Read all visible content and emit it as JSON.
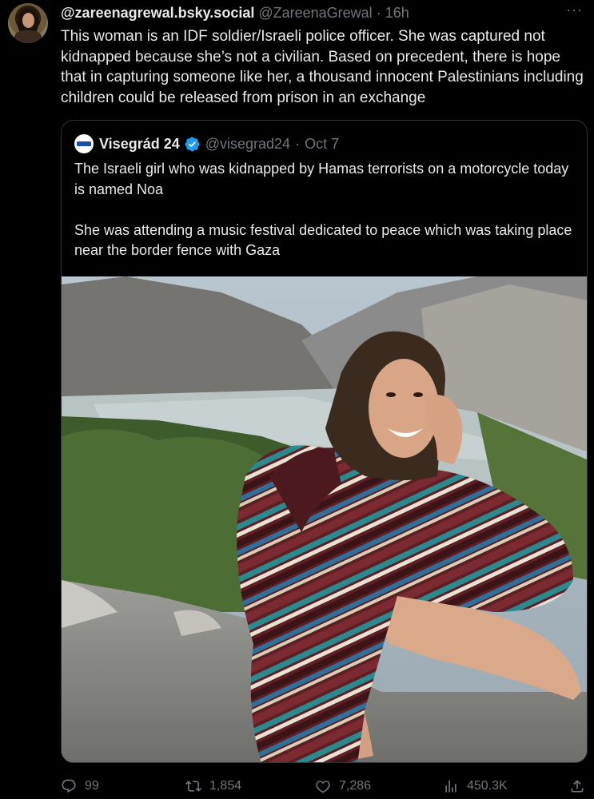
{
  "tweet": {
    "author_name": "@zareenagrewal.bsky.social",
    "author_handle": "@ZareenaGrewal",
    "separator": "·",
    "time": "16h",
    "more": "···",
    "text": "This woman is an IDF soldier/Israeli police officer. She was captured not kidnapped because she’s not a civilian. Based on precedent, there is hope that in capturing someone like her, a thousand innocent Palestinians including children could be released from prison in an exchange"
  },
  "quoted": {
    "author_name": "Visegrád 24",
    "author_handle": "@visegrad24",
    "separator": "·",
    "time": "Oct 7",
    "text": "The Israeli girl who was kidnapped by Hamas terrorists on a motorcycle today is named Noa\n\nShe was attending a music festival dedicated to peace which was taking place near the border fence with Gaza"
  },
  "actions": {
    "replies": "99",
    "retweets": "1,854",
    "likes": "7,286",
    "views": "450.3K"
  },
  "icons": {
    "reply": "reply-icon",
    "retweet": "retweet-icon",
    "like": "heart-icon",
    "views": "views-icon",
    "share": "share-icon",
    "verified": "verified-badge-icon",
    "more": "more-icon"
  },
  "colors": {
    "background": "#000000",
    "text": "#e7e9ea",
    "secondary": "#71767b",
    "border": "#2f3336",
    "verified": "#1d9bf0"
  }
}
